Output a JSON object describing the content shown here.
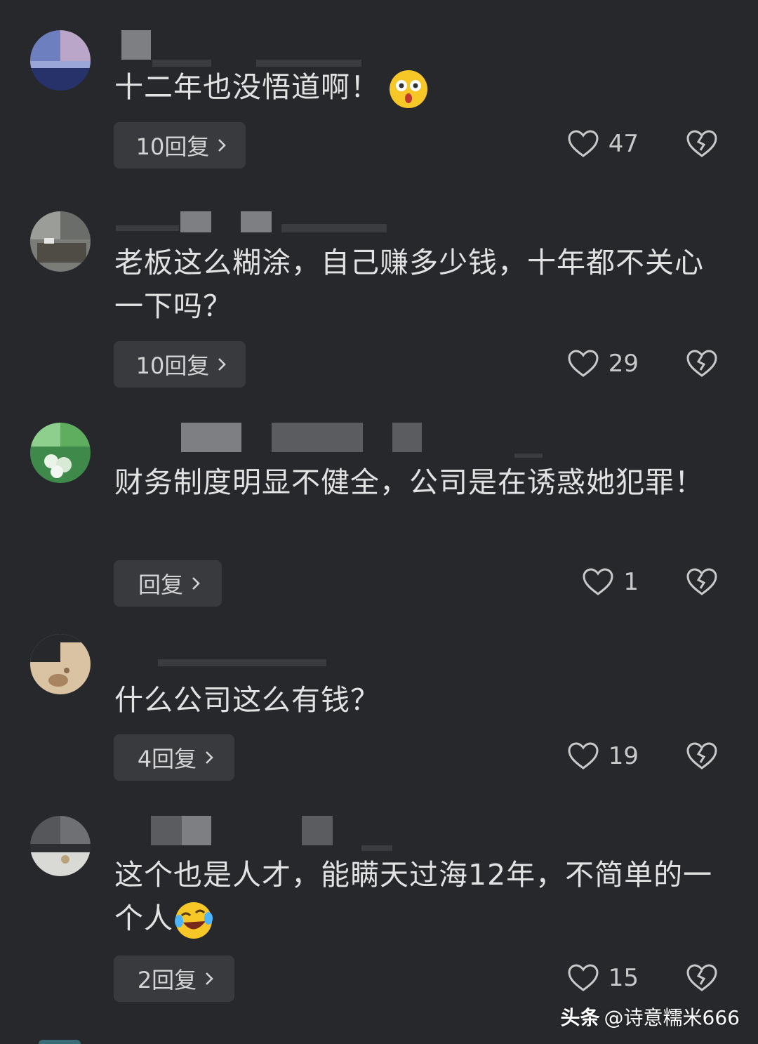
{
  "colors": {
    "background": "#27282c",
    "reply_button_bg": "#393a3e",
    "text": "#e2e2e2",
    "icon": "#c9c9c9"
  },
  "comments": [
    {
      "text": "十二年也没悟道啊！",
      "emoji": "shocked-face-icon",
      "reply_label": "10回复",
      "likes": "47"
    },
    {
      "text": "老板这么糊涂，自己赚多少钱，十年都不关心一下吗？",
      "reply_label": "10回复",
      "likes": "29"
    },
    {
      "text": "财务制度明显不健全，公司是在诱惑她犯罪！",
      "reply_label": "回复",
      "likes": "1"
    },
    {
      "text": "什么公司这么有钱？",
      "reply_label": "4回复",
      "likes": "19"
    },
    {
      "text": "这个也是人才，能瞒天过海12年，不简单的一个人",
      "emoji": "rolling-laughing-face-icon",
      "reply_label": "2回复",
      "likes": "15"
    }
  ],
  "watermark": {
    "brand": "头条",
    "handle": "@诗意糯米666"
  }
}
